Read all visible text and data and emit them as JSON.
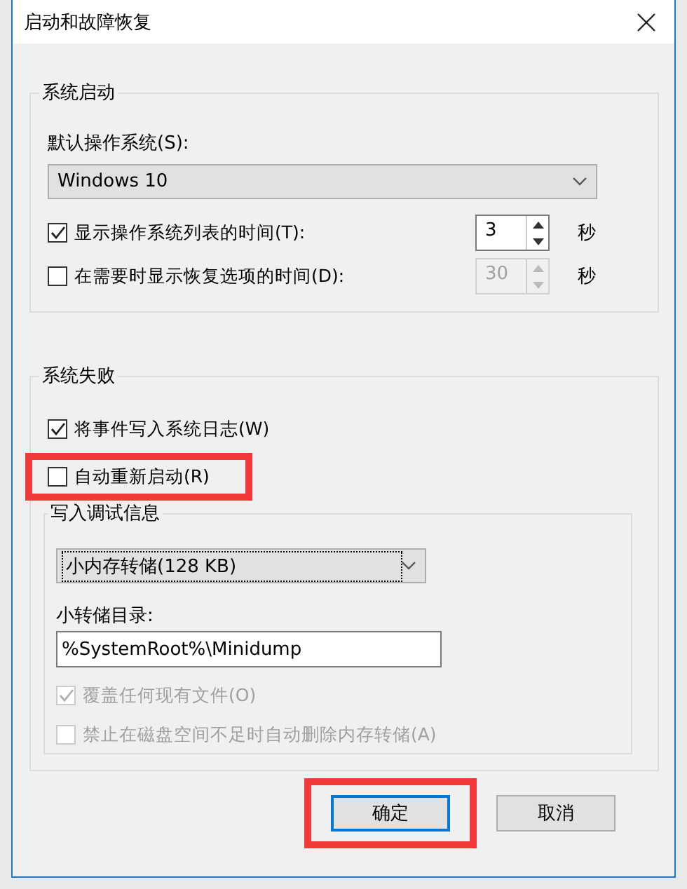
{
  "window": {
    "title": "启动和故障恢复"
  },
  "startup": {
    "title": "系统启动",
    "default_os_label": "默认操作系统(S):",
    "default_os": "Windows 10",
    "rows": [
      {
        "label": "显示操作系统列表的时间(T):",
        "checked": true,
        "value": "3",
        "disabled": false,
        "unit": "秒"
      },
      {
        "label": "在需要时显示恢复选项的时间(D):",
        "checked": false,
        "value": "30",
        "disabled": true,
        "unit": "秒"
      }
    ]
  },
  "failure": {
    "title": "系统失败",
    "options": [
      {
        "label": "将事件写入系统日志(W)",
        "checked": true,
        "highlighted": false
      },
      {
        "label": "自动重新启动(R)",
        "checked": false,
        "highlighted": true
      }
    ],
    "debug": {
      "title": "写入调试信息",
      "dump_type": "小内存转储(128 KB)",
      "dir_label": "小转储目录:",
      "dir": "%SystemRoot%\\Minidump",
      "options": [
        {
          "label": "覆盖任何现有文件(O)",
          "checked": true,
          "disabled": true
        },
        {
          "label": "禁止在磁盘空间不足时自动删除内存转储(A)",
          "checked": false,
          "disabled": true
        }
      ]
    }
  },
  "buttons": [
    {
      "label": "确定",
      "default": true,
      "highlighted": true
    },
    {
      "label": "取消",
      "default": false,
      "highlighted": false
    }
  ]
}
